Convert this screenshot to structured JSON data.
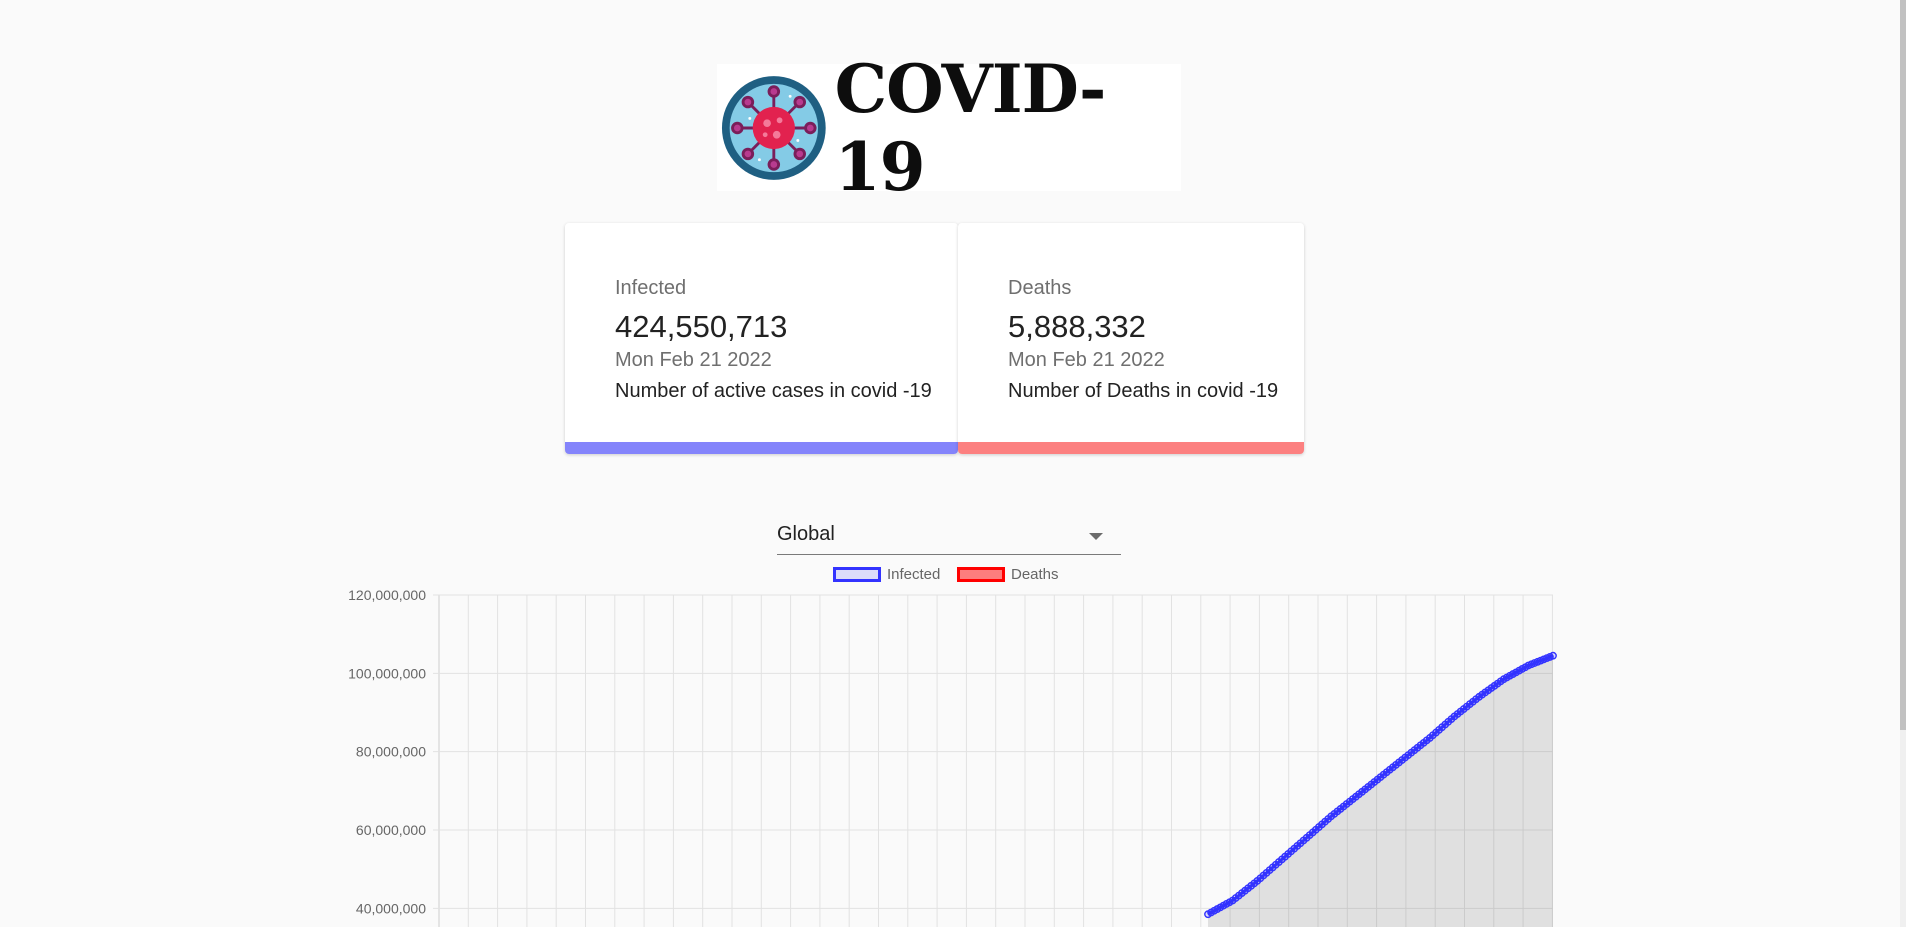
{
  "logo": {
    "text": "COVID-19",
    "icon": "virus-icon"
  },
  "cards": [
    {
      "label": "Infected",
      "value": "424,550,713",
      "date": "Mon Feb 21 2022",
      "description": "Number of active cases in covid -19",
      "color": "#8484fb"
    },
    {
      "label": "Deaths",
      "value": "5,888,332",
      "date": "Mon Feb 21 2022",
      "description": "Number of Deaths in covid -19",
      "color": "#fc8080"
    }
  ],
  "country_select": {
    "value": "Global"
  },
  "chart_data": {
    "type": "line",
    "legend": [
      {
        "name": "Infected",
        "border": "#3333ff",
        "fill": "rgba(51,51,255,0.15)"
      },
      {
        "name": "Deaths",
        "border": "#ff0000",
        "fill": "rgba(255,0,0,0.5)"
      }
    ],
    "y_ticks": [
      "120,000,000",
      "100,000,000",
      "80,000,000",
      "60,000,000",
      "40,000,000"
    ],
    "ylim": [
      0,
      120000000
    ],
    "grid": true,
    "series": [
      {
        "name": "Infected",
        "values": [
          38500000,
          42000000,
          47000000,
          52500000,
          58000000,
          63500000,
          68500000,
          73500000,
          78500000,
          83500000,
          89000000,
          94000000,
          98500000,
          102000000,
          104500000
        ]
      },
      {
        "name": "Deaths",
        "values": []
      }
    ]
  }
}
